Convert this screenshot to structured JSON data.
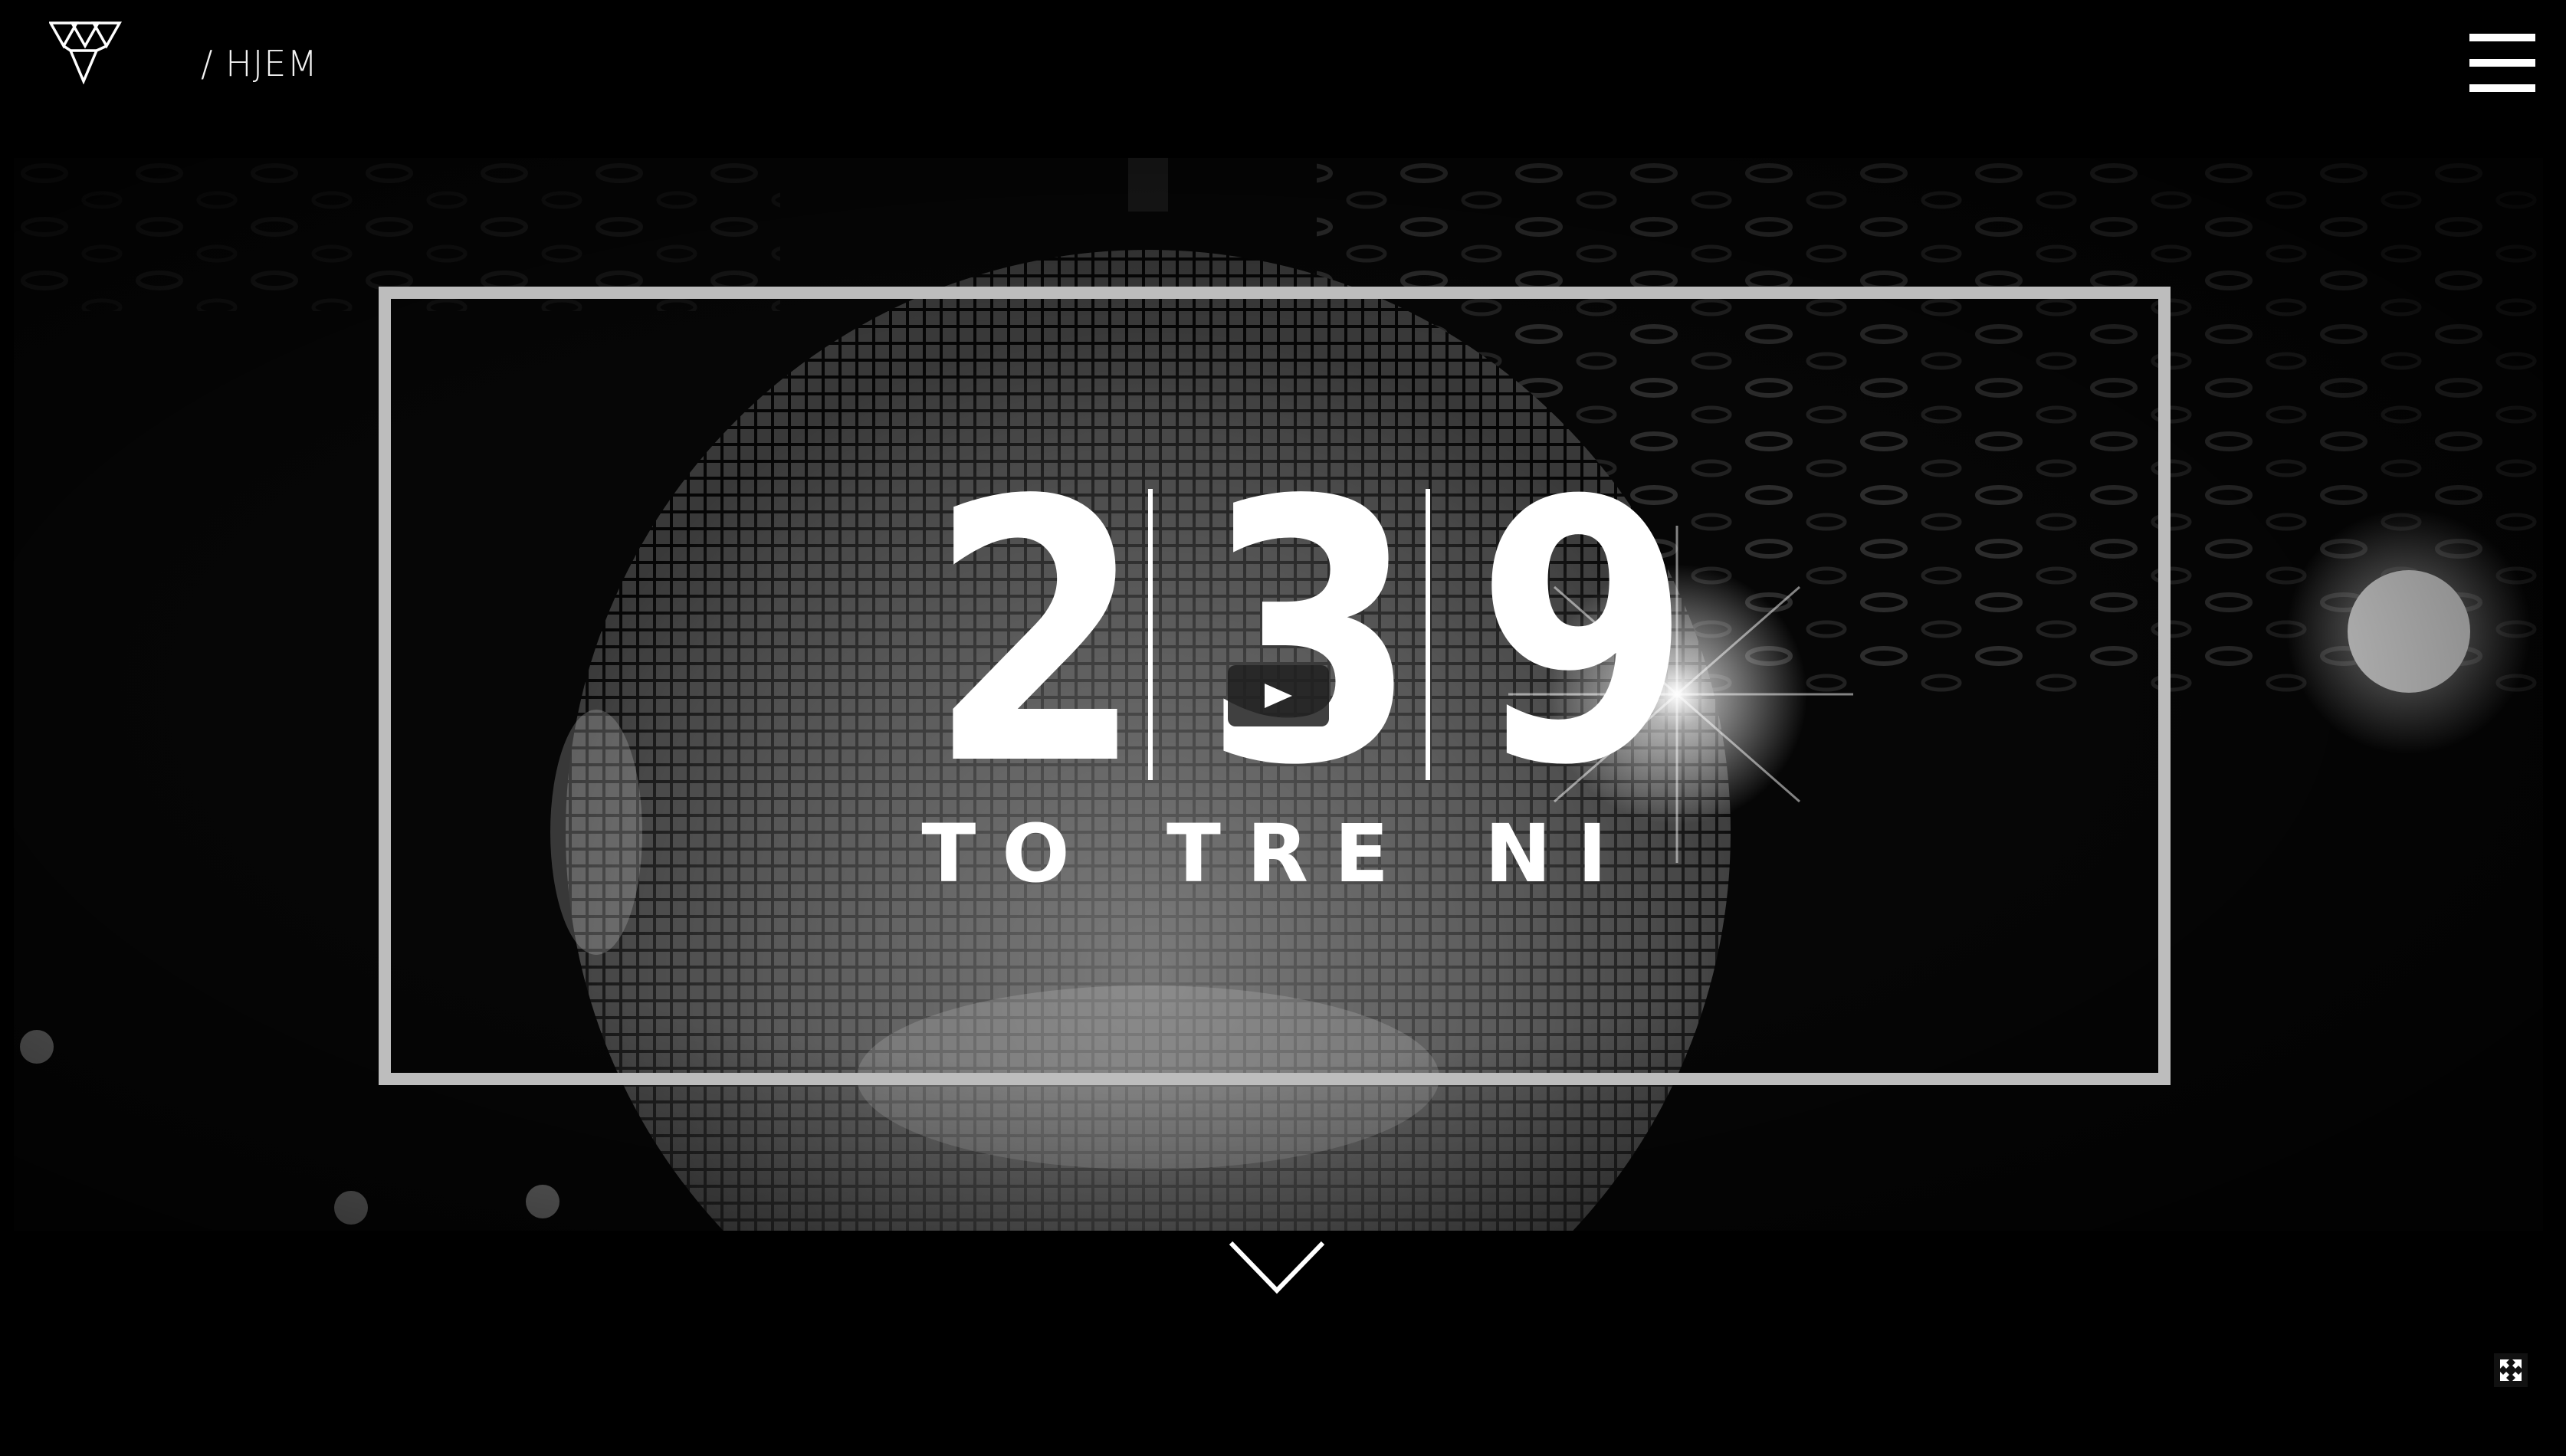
{
  "header": {
    "breadcrumb": "/ HJEM"
  },
  "hero": {
    "numbers": [
      "2",
      "3",
      "9"
    ],
    "words": [
      "TO",
      "TRE",
      "NI"
    ]
  },
  "icons": {
    "logo": "triangle-logo-icon",
    "menu": "hamburger-menu-icon",
    "play": "play-icon",
    "scroll": "chevron-down-icon",
    "fullscreen": "fullscreen-icon"
  },
  "colors": {
    "background": "#000000",
    "frame": "#bdbdbd",
    "text": "#ffffff"
  }
}
